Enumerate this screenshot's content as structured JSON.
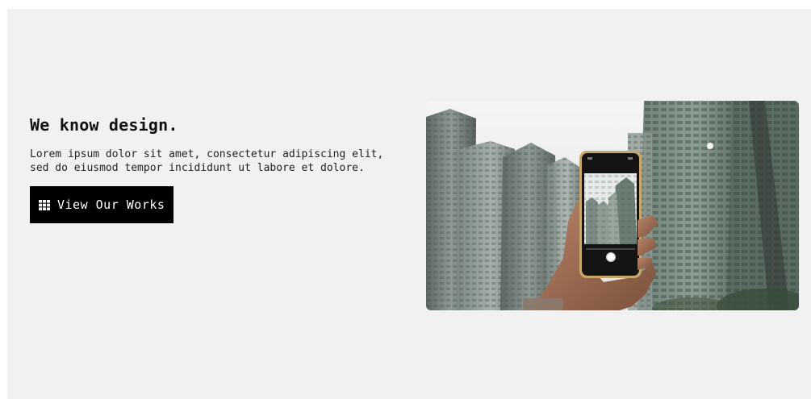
{
  "hero": {
    "title": "We know design.",
    "body": "Lorem ipsum dolor sit amet, consectetur adipiscing elit, sed do eiusmod tempor incididunt ut labore et dolore.",
    "cta_label": "View Our Works",
    "cta_icon": "grid-icon",
    "image_subject": "hand-holding-phone-photographing-skyscrapers"
  },
  "colors": {
    "background": "#f1f1f1",
    "button": "#000000",
    "button_text": "#ffffff",
    "text": "#111111"
  }
}
